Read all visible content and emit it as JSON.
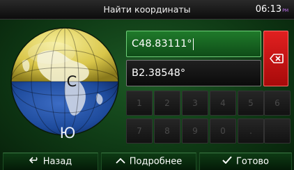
{
  "header": {
    "title": "Найти координаты",
    "time": "06:13",
    "ampm": "PM"
  },
  "hemisphere": {
    "north_label": "С",
    "south_label": "Ю"
  },
  "latitude": {
    "value": "С48.83111°"
  },
  "longitude": {
    "value": "В2.38548°"
  },
  "keypad": {
    "row1": [
      "1",
      "2",
      "3",
      "4",
      "5",
      "6"
    ],
    "row2": [
      "7",
      "8",
      "9",
      "0",
      "."
    ]
  },
  "footer": {
    "back_label": "Назад",
    "more_label": "Подробнее",
    "done_label": "Готово"
  },
  "colors": {
    "accent_green": "#1f7a2a",
    "delete_red": "#c41414",
    "globe_yellow": "#e8d860",
    "globe_blue": "#1e4b9c"
  }
}
